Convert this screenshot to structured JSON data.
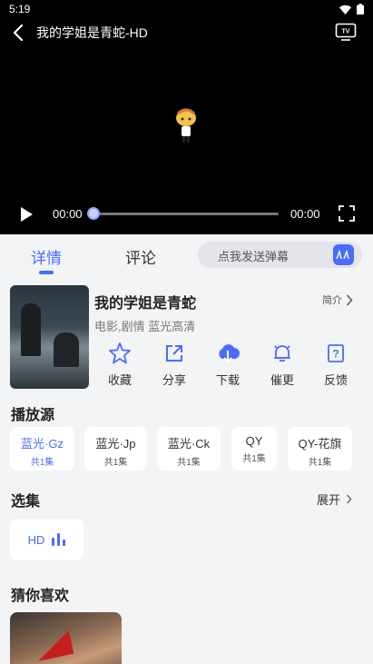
{
  "status_bar": {
    "time": "5:19"
  },
  "player": {
    "title": "我的学姐是青蛇-HD",
    "current_time": "00:00",
    "total_time": "00:00",
    "progress": 0
  },
  "tabs": [
    {
      "label": "详情",
      "active": true
    },
    {
      "label": "评论",
      "active": false
    }
  ],
  "danmaku": {
    "placeholder": "点我发送弹幕"
  },
  "movie": {
    "name": "我的学姐是青蛇",
    "intro_label": "简介",
    "genre": "电影,剧情 蓝光高清"
  },
  "actions": [
    {
      "label": "收藏",
      "icon": "star-icon"
    },
    {
      "label": "分享",
      "icon": "share-icon"
    },
    {
      "label": "下载",
      "icon": "download-icon"
    },
    {
      "label": "催更",
      "icon": "bell-icon"
    },
    {
      "label": "反馈",
      "icon": "feedback-icon"
    }
  ],
  "sources_section": {
    "title": "播放源",
    "items": [
      {
        "name": "蓝光·Gz",
        "count": "共1集",
        "active": true
      },
      {
        "name": "蓝光·Jp",
        "count": "共1集",
        "active": false
      },
      {
        "name": "蓝光·Ck",
        "count": "共1集",
        "active": false
      },
      {
        "name": "QY",
        "count": "共1集",
        "active": false
      },
      {
        "name": "QY-花旗",
        "count": "共1集",
        "active": false
      }
    ]
  },
  "episodes_section": {
    "title": "选集",
    "expand_label": "展开",
    "episode": "HD"
  },
  "recommend_section": {
    "title": "猜你喜欢"
  },
  "colors": {
    "accent": "#4b6bff",
    "player_bg": "#000000",
    "page_bg": "#f3f4f6"
  }
}
